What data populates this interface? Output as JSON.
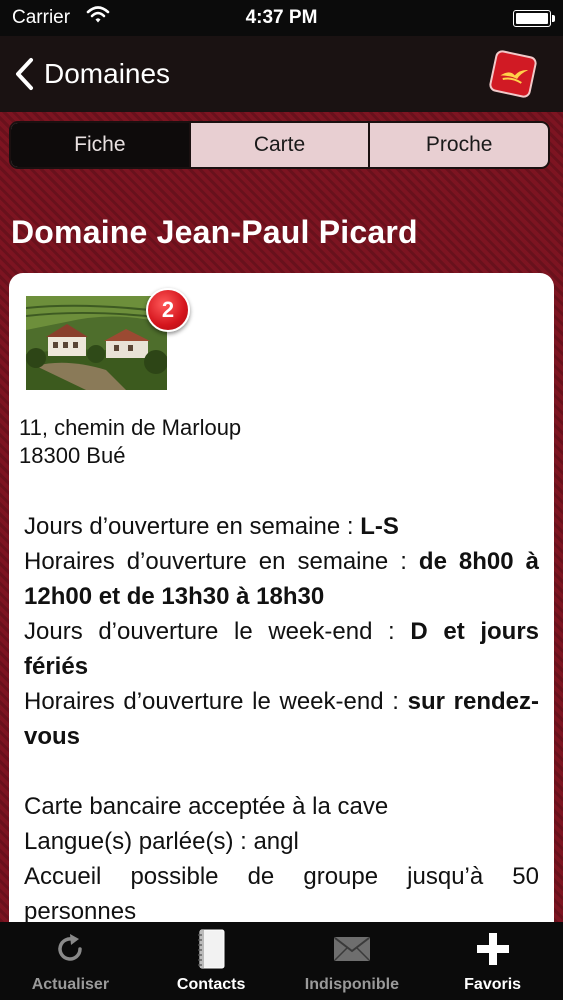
{
  "status_bar": {
    "carrier": "Carrier",
    "time": "4:37 PM"
  },
  "nav": {
    "back_label": "Domaines",
    "logo_icon": "brand-logo-bird-icon"
  },
  "segments": [
    "Fiche",
    "Carte",
    "Proche"
  ],
  "selected_segment": "Fiche",
  "domain_title": "Domaine Jean-Paul Picard",
  "photo": {
    "badge_count": "2"
  },
  "address": {
    "line1": "11, chemin de Marloup",
    "line2": "18300 Bué"
  },
  "hours": {
    "weekday_days_label": "Jours d’ouverture en semaine : ",
    "weekday_days_value": "L-S",
    "weekday_hours_label": "Horaires d’ouverture en semaine : ",
    "weekday_hours_value": "de 8h00 à 12h00 et de 13h30 à 18h30",
    "weekend_days_label": "Jours d’ouverture le week-end : ",
    "weekend_days_value": "D et jours fériés",
    "weekend_hours_label": "Horaires d’ouverture le week-end : ",
    "weekend_hours_value": "sur rendez-vous"
  },
  "services": {
    "card": "Carte bancaire acceptée à la cave",
    "languages": "Langue(s) parlée(s) : angl",
    "groups": "Accueil possible de groupe jusqu’à 50 personnes"
  },
  "tabbar": {
    "refresh": "Actualiser",
    "contacts": "Contacts",
    "unavailable": "Indisponible",
    "favorites": "Favoris"
  },
  "colors": {
    "accent": "#7d1421",
    "badge": "#d4141c",
    "bar": "#0b0b0b"
  }
}
